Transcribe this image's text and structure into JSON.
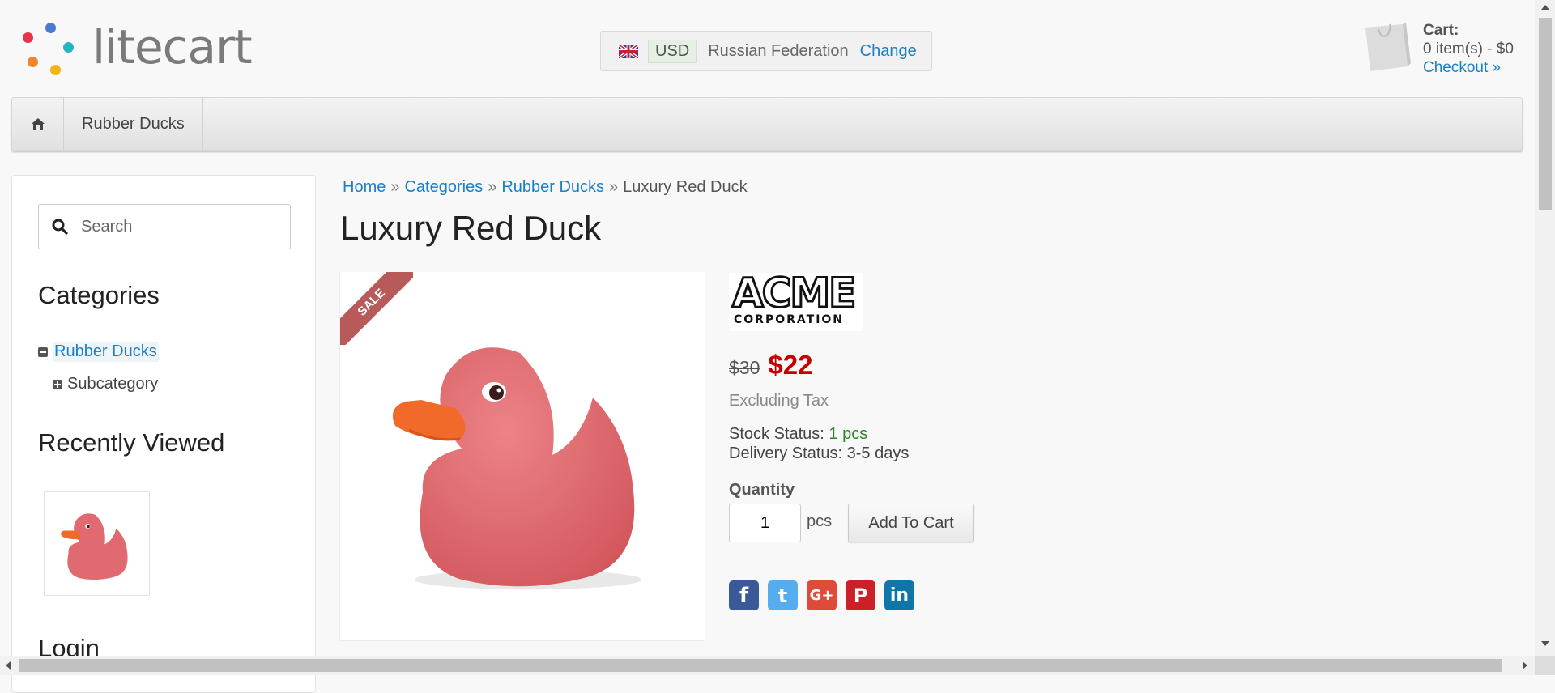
{
  "header": {
    "logo_text": "litecart",
    "region": {
      "currency": "USD",
      "country": "Russian Federation",
      "change_label": "Change"
    },
    "cart": {
      "title": "Cart:",
      "summary": "0 item(s) - $0",
      "checkout_label": "Checkout »"
    }
  },
  "navbar": {
    "items": [
      {
        "label": "Rubber Ducks"
      }
    ]
  },
  "sidebar": {
    "search": {
      "placeholder": "Search"
    },
    "categories_title": "Categories",
    "categories": [
      {
        "label": "Rubber Ducks"
      },
      {
        "label": "Subcategory"
      }
    ],
    "recently_viewed_title": "Recently Viewed",
    "login_title": "Login"
  },
  "breadcrumb": [
    "Home",
    "Categories",
    "Rubber Ducks",
    "Luxury Red Duck"
  ],
  "product": {
    "title": "Luxury Red Duck",
    "badge": "SALE",
    "manufacturer_logo": {
      "name": "ACME",
      "subtitle": "CORPORATION"
    },
    "old_price": "$30",
    "price": "$22",
    "tax_note": "Excluding Tax",
    "stock_label": "Stock Status:",
    "stock_value": "1 pcs",
    "delivery": "Delivery Status: 3-5 days",
    "quantity_label": "Quantity",
    "quantity_value": "1",
    "unit": "pcs",
    "add_to_cart_label": "Add To Cart"
  },
  "social": [
    {
      "icon": "facebook-icon",
      "glyph": "f",
      "color": "#3b5998"
    },
    {
      "icon": "twitter-icon",
      "glyph": "t",
      "color": "#55acee"
    },
    {
      "icon": "google-plus-icon",
      "glyph": "G+",
      "color": "#dd4b39"
    },
    {
      "icon": "pinterest-icon",
      "glyph": "P",
      "color": "#cb2027"
    },
    {
      "icon": "linkedin-icon",
      "glyph": "in",
      "color": "#0e76a8"
    }
  ],
  "colors": {
    "link": "#1a7fc6",
    "sale_price": "#c40000",
    "in_stock": "#2a8a2a",
    "duck": "#e06a6f"
  }
}
